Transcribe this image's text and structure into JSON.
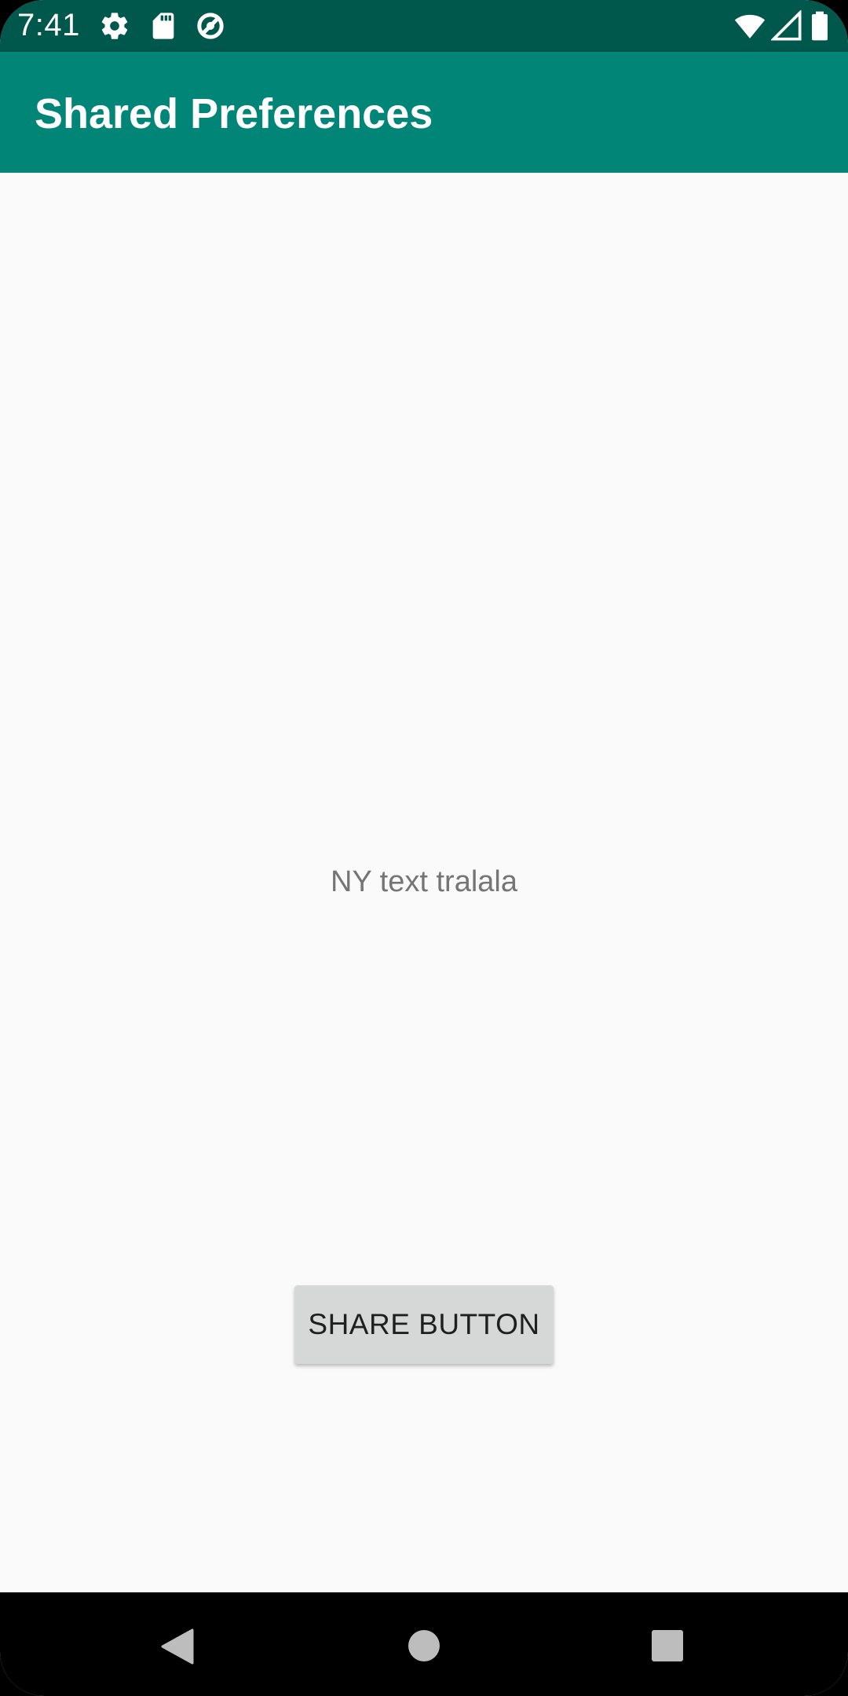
{
  "status_bar": {
    "time": "7:41",
    "background_color": "#00574b",
    "left_icons": [
      "gear-icon",
      "sd-card-icon",
      "data-saver-icon"
    ],
    "right_icons": [
      "wifi-icon",
      "cell-signal-icon",
      "battery-icon"
    ]
  },
  "app_bar": {
    "title": "Shared Preferences",
    "background_color": "#008577"
  },
  "main": {
    "center_text": "NY text tralala",
    "share_button_label": "SHARE BUTTON"
  },
  "nav_bar": {
    "buttons": [
      "back-icon",
      "home-icon",
      "recents-icon"
    ]
  }
}
